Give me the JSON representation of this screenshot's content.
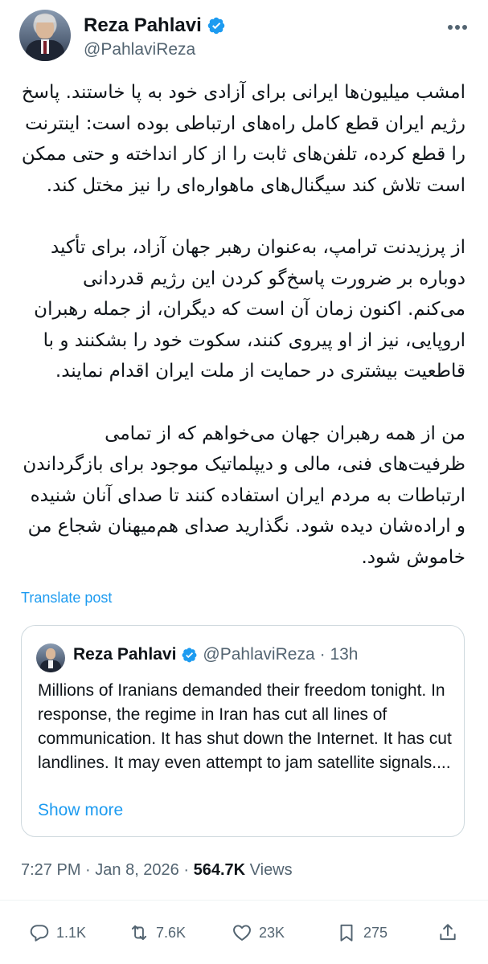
{
  "tweet": {
    "author": {
      "display_name": "Reza Pahlavi",
      "handle": "@PahlaviReza",
      "verified": true
    },
    "paragraphs": [
      "امشب میلیون‌ها ایرانی برای آزادی خود به پا خاستند. پاسخ رژیم ایران قطع کامل راه‌های ارتباطی بوده است: اینترنت را قطع کرده، تلفن‌های ثابت را از کار انداخته و حتی ممکن است تلاش کند سیگنال‌های ماهواره‌ای را نیز مختل کند.",
      "از پرزیدنت ترامپ، به‌عنوان رهبر جهان آزاد، برای تأکید دوباره بر ضرورت پاسخ‌گو کردن این رژیم قدردانی می‌کنم. اکنون زمان آن است که دیگران، از جمله رهبران اروپایی، نیز از او پیروی کنند، سکوت خود را بشکنند و با قاطعیت بیشتری در حمایت از ملت ایران اقدام نمایند.",
      "من از همه رهبران جهان می‌خواهم که از تمامی ظرفیت‌های فنی، مالی و دیپلماتیک موجود برای بازگرداندن ارتباطات به مردم ایران استفاده کنند تا صدای آنان شنیده و اراده‌شان دیده شود. نگذارید صدای هم‌میهنان شجاع من خاموش شود."
    ],
    "translate_label": "Translate post",
    "quoted": {
      "display_name": "Reza Pahlavi",
      "handle": "@PahlaviReza",
      "age": "· 13h",
      "text": "Millions of Iranians demanded their freedom tonight. In response, the regime in Iran has cut all lines of communication. It has shut down the Internet. It has cut landlines. It may even attempt to jam satellite signals....",
      "show_more": "Show more"
    },
    "time": "7:27 PM",
    "date": "· Jan 8, 2026 ·",
    "views_count": "564.7K",
    "views_label": "Views",
    "actions": {
      "replies": "1.1K",
      "reposts": "7.6K",
      "likes": "23K",
      "bookmarks": "275"
    },
    "accent_color": "#1d9bf0"
  }
}
